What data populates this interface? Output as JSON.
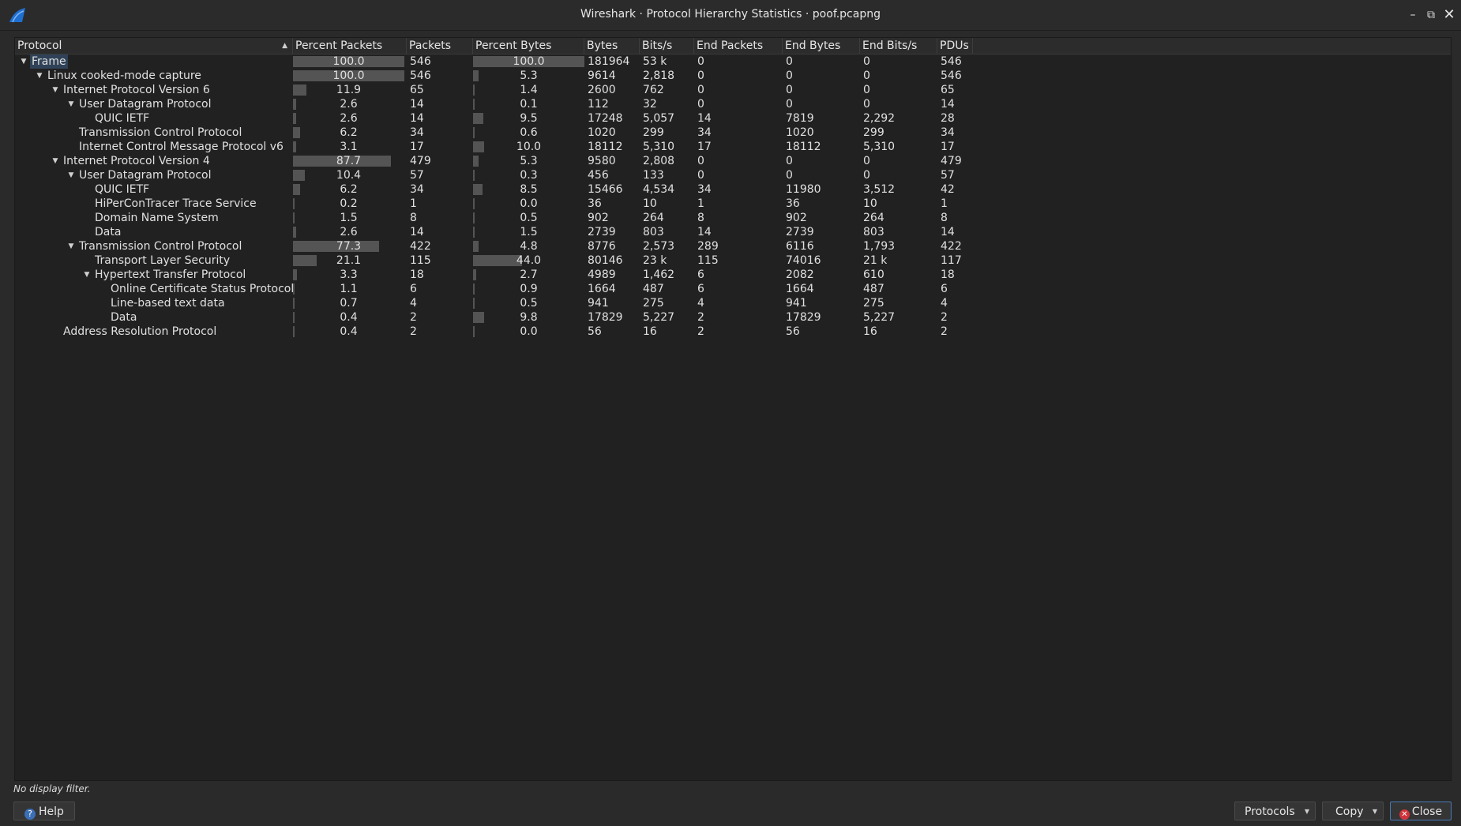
{
  "window": {
    "title": "Wireshark · Protocol Hierarchy Statistics · poof.pcapng",
    "min_glyph": "–",
    "max_glyph": "⧉",
    "close_glyph": "✕"
  },
  "columns": [
    "Protocol",
    "Percent Packets",
    "Packets",
    "Percent Bytes",
    "Bytes",
    "Bits/s",
    "End Packets",
    "End Bytes",
    "End Bits/s",
    "PDUs"
  ],
  "rows": [
    {
      "protocol": "Frame",
      "depth": 0,
      "expanded": true,
      "pct_packets": "100.0",
      "packets": "546",
      "pct_bytes": "100.0",
      "bytes": "181964",
      "bits": "53 k",
      "end_packets": "0",
      "end_bytes": "0",
      "end_bits": "0",
      "pdus": "546"
    },
    {
      "protocol": "Linux cooked-mode capture",
      "depth": 1,
      "expanded": true,
      "pct_packets": "100.0",
      "packets": "546",
      "pct_bytes": "5.3",
      "bytes": "9614",
      "bits": "2,818",
      "end_packets": "0",
      "end_bytes": "0",
      "end_bits": "0",
      "pdus": "546"
    },
    {
      "protocol": "Internet Protocol Version 6",
      "depth": 2,
      "expanded": true,
      "pct_packets": "11.9",
      "packets": "65",
      "pct_bytes": "1.4",
      "bytes": "2600",
      "bits": "762",
      "end_packets": "0",
      "end_bytes": "0",
      "end_bits": "0",
      "pdus": "65"
    },
    {
      "protocol": "User Datagram Protocol",
      "depth": 3,
      "expanded": true,
      "pct_packets": "2.6",
      "packets": "14",
      "pct_bytes": "0.1",
      "bytes": "112",
      "bits": "32",
      "end_packets": "0",
      "end_bytes": "0",
      "end_bits": "0",
      "pdus": "14"
    },
    {
      "protocol": "QUIC IETF",
      "depth": 4,
      "expanded": null,
      "pct_packets": "2.6",
      "packets": "14",
      "pct_bytes": "9.5",
      "bytes": "17248",
      "bits": "5,057",
      "end_packets": "14",
      "end_bytes": "7819",
      "end_bits": "2,292",
      "pdus": "28"
    },
    {
      "protocol": "Transmission Control Protocol",
      "depth": 3,
      "expanded": null,
      "pct_packets": "6.2",
      "packets": "34",
      "pct_bytes": "0.6",
      "bytes": "1020",
      "bits": "299",
      "end_packets": "34",
      "end_bytes": "1020",
      "end_bits": "299",
      "pdus": "34"
    },
    {
      "protocol": "Internet Control Message Protocol v6",
      "depth": 3,
      "expanded": null,
      "pct_packets": "3.1",
      "packets": "17",
      "pct_bytes": "10.0",
      "bytes": "18112",
      "bits": "5,310",
      "end_packets": "17",
      "end_bytes": "18112",
      "end_bits": "5,310",
      "pdus": "17"
    },
    {
      "protocol": "Internet Protocol Version 4",
      "depth": 2,
      "expanded": true,
      "pct_packets": "87.7",
      "packets": "479",
      "pct_bytes": "5.3",
      "bytes": "9580",
      "bits": "2,808",
      "end_packets": "0",
      "end_bytes": "0",
      "end_bits": "0",
      "pdus": "479"
    },
    {
      "protocol": "User Datagram Protocol",
      "depth": 3,
      "expanded": true,
      "pct_packets": "10.4",
      "packets": "57",
      "pct_bytes": "0.3",
      "bytes": "456",
      "bits": "133",
      "end_packets": "0",
      "end_bytes": "0",
      "end_bits": "0",
      "pdus": "57"
    },
    {
      "protocol": "QUIC IETF",
      "depth": 4,
      "expanded": null,
      "pct_packets": "6.2",
      "packets": "34",
      "pct_bytes": "8.5",
      "bytes": "15466",
      "bits": "4,534",
      "end_packets": "34",
      "end_bytes": "11980",
      "end_bits": "3,512",
      "pdus": "42"
    },
    {
      "protocol": "HiPerConTracer Trace Service",
      "depth": 4,
      "expanded": null,
      "pct_packets": "0.2",
      "packets": "1",
      "pct_bytes": "0.0",
      "bytes": "36",
      "bits": "10",
      "end_packets": "1",
      "end_bytes": "36",
      "end_bits": "10",
      "pdus": "1"
    },
    {
      "protocol": "Domain Name System",
      "depth": 4,
      "expanded": null,
      "pct_packets": "1.5",
      "packets": "8",
      "pct_bytes": "0.5",
      "bytes": "902",
      "bits": "264",
      "end_packets": "8",
      "end_bytes": "902",
      "end_bits": "264",
      "pdus": "8"
    },
    {
      "protocol": "Data",
      "depth": 4,
      "expanded": null,
      "pct_packets": "2.6",
      "packets": "14",
      "pct_bytes": "1.5",
      "bytes": "2739",
      "bits": "803",
      "end_packets": "14",
      "end_bytes": "2739",
      "end_bits": "803",
      "pdus": "14"
    },
    {
      "protocol": "Transmission Control Protocol",
      "depth": 3,
      "expanded": true,
      "pct_packets": "77.3",
      "packets": "422",
      "pct_bytes": "4.8",
      "bytes": "8776",
      "bits": "2,573",
      "end_packets": "289",
      "end_bytes": "6116",
      "end_bits": "1,793",
      "pdus": "422"
    },
    {
      "protocol": "Transport Layer Security",
      "depth": 4,
      "expanded": null,
      "pct_packets": "21.1",
      "packets": "115",
      "pct_bytes": "44.0",
      "bytes": "80146",
      "bits": "23 k",
      "end_packets": "115",
      "end_bytes": "74016",
      "end_bits": "21 k",
      "pdus": "117"
    },
    {
      "protocol": "Hypertext Transfer Protocol",
      "depth": 4,
      "expanded": true,
      "pct_packets": "3.3",
      "packets": "18",
      "pct_bytes": "2.7",
      "bytes": "4989",
      "bits": "1,462",
      "end_packets": "6",
      "end_bytes": "2082",
      "end_bits": "610",
      "pdus": "18"
    },
    {
      "protocol": "Online Certificate Status Protocol",
      "depth": 5,
      "expanded": null,
      "pct_packets": "1.1",
      "packets": "6",
      "pct_bytes": "0.9",
      "bytes": "1664",
      "bits": "487",
      "end_packets": "6",
      "end_bytes": "1664",
      "end_bits": "487",
      "pdus": "6"
    },
    {
      "protocol": "Line-based text data",
      "depth": 5,
      "expanded": null,
      "pct_packets": "0.7",
      "packets": "4",
      "pct_bytes": "0.5",
      "bytes": "941",
      "bits": "275",
      "end_packets": "4",
      "end_bytes": "941",
      "end_bits": "275",
      "pdus": "4"
    },
    {
      "protocol": "Data",
      "depth": 5,
      "expanded": null,
      "pct_packets": "0.4",
      "packets": "2",
      "pct_bytes": "9.8",
      "bytes": "17829",
      "bits": "5,227",
      "end_packets": "2",
      "end_bytes": "17829",
      "end_bits": "5,227",
      "pdus": "2"
    },
    {
      "protocol": "Address Resolution Protocol",
      "depth": 2,
      "expanded": null,
      "pct_packets": "0.4",
      "packets": "2",
      "pct_bytes": "0.0",
      "bytes": "56",
      "bits": "16",
      "end_packets": "2",
      "end_bytes": "56",
      "end_bits": "16",
      "pdus": "2"
    }
  ],
  "status": {
    "filter_text": "No display filter."
  },
  "buttons": {
    "help": "Help",
    "protocols": "Protocols",
    "copy": "Copy",
    "close": "Close"
  },
  "colors": {
    "background": "#2a2a2a",
    "tree_bg": "#212121",
    "bar": "#545454",
    "selection": "#2f4257",
    "close_accent": "#4a7ab8"
  }
}
